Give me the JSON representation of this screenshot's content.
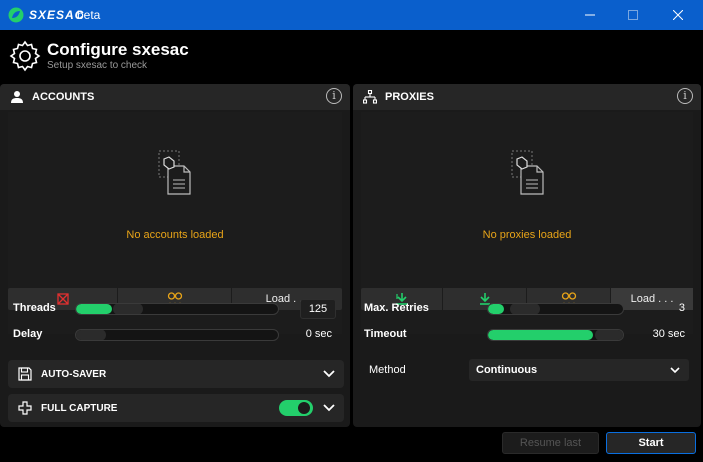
{
  "titlebar": {
    "app_name": "SXESAC",
    "app_suffix": "beta",
    "logo_icon": "leaf-logo-icon",
    "accent_color": "#0a5fcc"
  },
  "header": {
    "title": "Configure sxesac",
    "subtitle": "Setup sxesac to check",
    "icon": "gear-icon"
  },
  "accounts": {
    "title": "ACCOUNTS",
    "empty_message": "No accounts loaded",
    "load_label": "Load . . .",
    "threads": {
      "label": "Threads",
      "value": "125",
      "fill_percent": 18
    },
    "delay": {
      "label": "Delay",
      "value": "0 sec",
      "fill_percent": 0
    }
  },
  "proxies": {
    "title": "PROXIES",
    "empty_message": "No proxies loaded",
    "load_label": "Load . . .",
    "max_retries": {
      "label": "Max. Retries",
      "value": "3",
      "fill_percent": 12
    },
    "timeout": {
      "label": "Timeout",
      "value": "30 sec",
      "fill_percent": 78
    },
    "method": {
      "label": "Method",
      "value": "Continuous"
    }
  },
  "auto_saver": {
    "title": "AUTO-SAVER",
    "expanded": false
  },
  "full_capture": {
    "title": "FULL CAPTURE",
    "enabled": true
  },
  "footer": {
    "resume_label": "Resume last",
    "start_label": "Start"
  },
  "colors": {
    "success": "#23cf6b",
    "warning": "#e8a418",
    "danger": "#e03030"
  }
}
